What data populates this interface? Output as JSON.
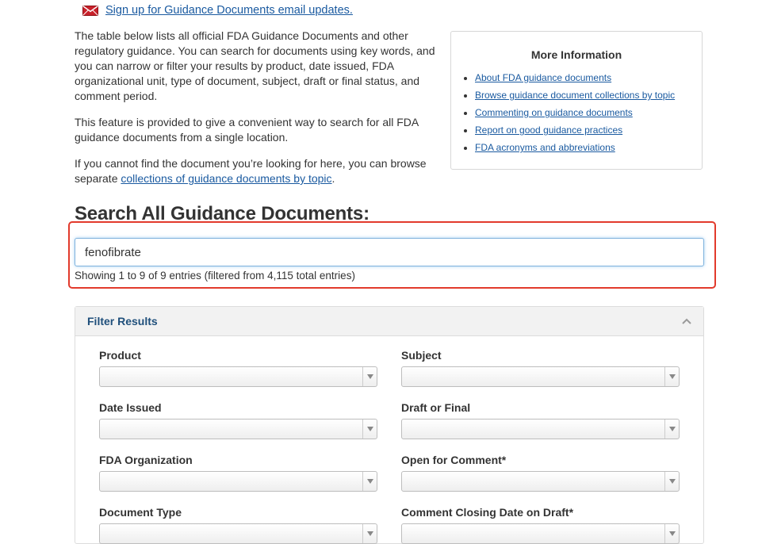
{
  "signup": {
    "icon": "envelope-icon",
    "link_text": "Sign up for Guidance Documents email updates."
  },
  "intro": {
    "p1": "The table below lists all official FDA Guidance Documents and other regulatory guidance. You can search for documents using key words, and you can narrow or filter your results by product, date issued, FDA organizational unit, type of document, subject, draft or final status, and comment period.",
    "p2": "This feature is provided to give a convenient way to search for all FDA guidance documents from a single location.",
    "p3_before": "If you cannot find the document you’re looking for here, you can browse separate ",
    "p3_link": "collections of guidance documents by topic",
    "p3_after": "."
  },
  "more_info": {
    "title": "More Information",
    "links": [
      "About FDA guidance documents",
      "Browse guidance document collections by topic",
      "Commenting on guidance documents",
      "Report on good guidance practices",
      "FDA acronyms and abbreviations"
    ]
  },
  "search": {
    "title": "Search All Guidance Documents:",
    "value": "fenofibrate",
    "entries_info": "Showing 1 to 9 of 9 entries (filtered from 4,115 total entries)"
  },
  "filter": {
    "title": "Filter Results",
    "fields": {
      "product": "Product",
      "subject": "Subject",
      "date_issued": "Date Issued",
      "draft_final": "Draft or Final",
      "fda_org": "FDA Organization",
      "open_comment": "Open for Comment*",
      "doc_type": "Document Type",
      "comment_closing": "Comment Closing Date on Draft*"
    }
  },
  "colors": {
    "link": "#1a5aa0",
    "highlight": "#e23a2c",
    "filter_title": "#1f4f7b"
  }
}
